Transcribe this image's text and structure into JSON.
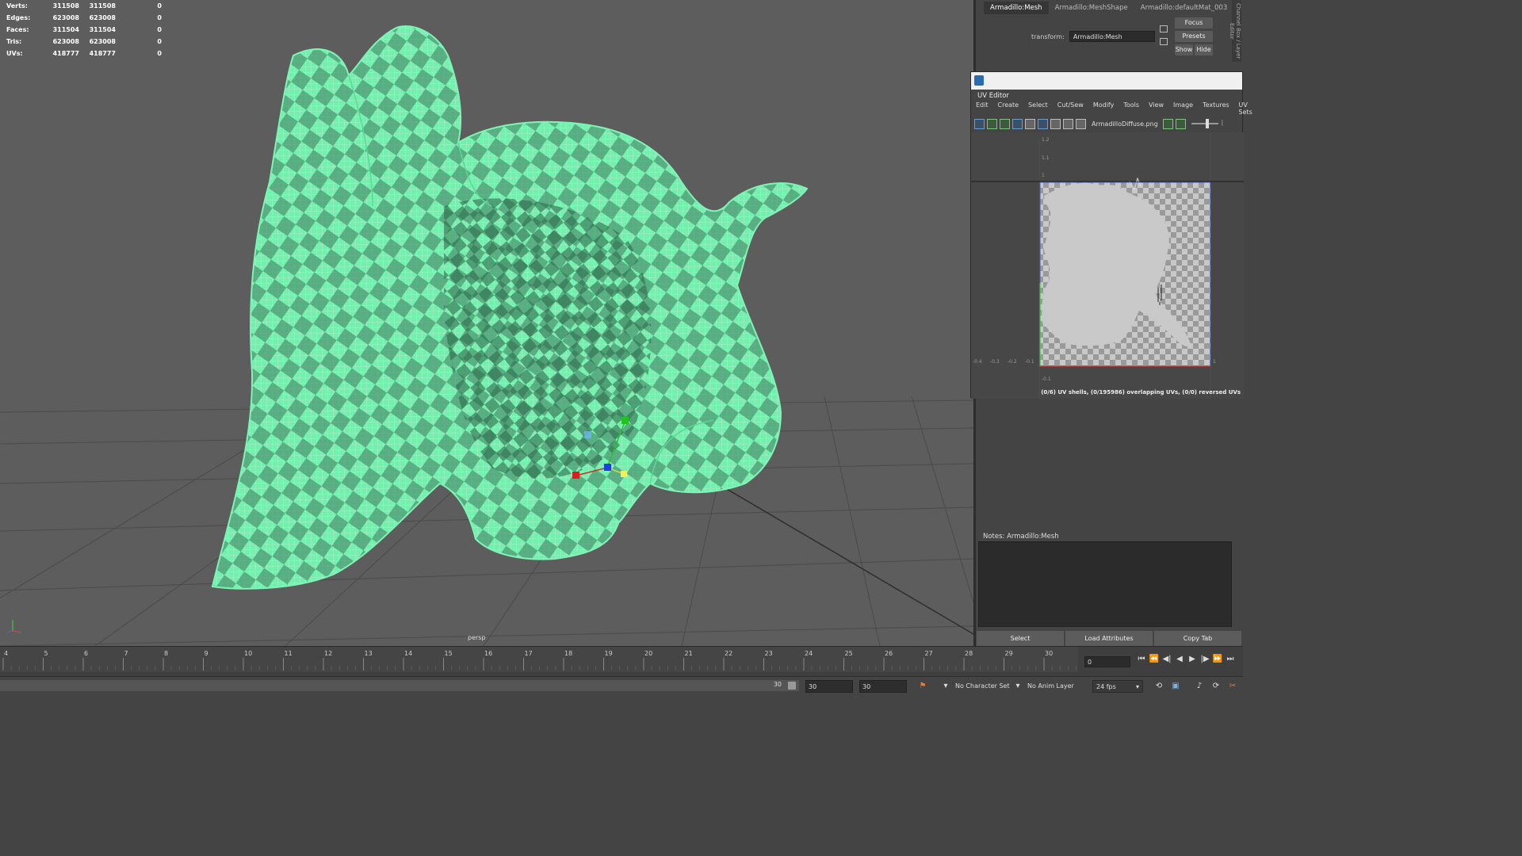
{
  "hud": {
    "rows": [
      {
        "label": "Verts:",
        "a": "311508",
        "b": "311508",
        "c": "0"
      },
      {
        "label": "Edges:",
        "a": "623008",
        "b": "623008",
        "c": "0"
      },
      {
        "label": "Faces:",
        "a": "311504",
        "b": "311504",
        "c": "0"
      },
      {
        "label": "Tris:",
        "a": "623008",
        "b": "623008",
        "c": "0"
      },
      {
        "label": "UVs:",
        "a": "418777",
        "b": "418777",
        "c": "0"
      }
    ]
  },
  "viewport": {
    "camera_label": "persp",
    "mesh_color": "#6ff0a6"
  },
  "attribute_editor": {
    "tabs": [
      "Armadillo:Mesh",
      "Armadillo:MeshShape",
      "Armadillo:defaultMat_003"
    ],
    "transform_label": "transform:",
    "transform_value": "Armadillo:Mesh",
    "focus_label": "Focus",
    "presets_label": "Presets",
    "show_label": "Show",
    "hide_label": "Hide",
    "side_tab": "Channel Box / Layer Editor",
    "notes_label": "Notes:  Armadillo:Mesh",
    "buttons": [
      "Select",
      "Load Attributes",
      "Copy Tab"
    ]
  },
  "uv_editor": {
    "title": "UV Editor",
    "menu": [
      "Edit",
      "Create",
      "Select",
      "Cut/Sew",
      "Modify",
      "Tools",
      "View",
      "Image",
      "Textures",
      "UV Sets"
    ],
    "texture_name": "ArmadilloDiffuse.png",
    "status": "(0/6) UV shells, (0/195986) overlapping UVs, (0/0) reversed UVs",
    "v_ticks": [
      "1.2",
      "1.1",
      "1"
    ],
    "u_ticks": [
      "-0.4",
      "-0.3",
      "-0.2",
      "-0.1"
    ],
    "bottom_tick": "-0.1",
    "right_tick": "1"
  },
  "timeline": {
    "frames": [
      "4",
      "5",
      "6",
      "7",
      "8",
      "9",
      "10",
      "11",
      "12",
      "13",
      "14",
      "15",
      "16",
      "17",
      "18",
      "19",
      "20",
      "21",
      "22",
      "23",
      "24",
      "25",
      "26",
      "27",
      "28",
      "29",
      "30"
    ],
    "current_frame": "0",
    "controls": [
      "⏮",
      "⏪",
      "◀|",
      "◀",
      "▶",
      "|▶",
      "⏩",
      "⏭"
    ]
  },
  "range_bar": {
    "range_end": "30",
    "start_field": "30",
    "end_field": "30",
    "character_set": "No Character Set",
    "anim_layer": "No Anim Layer",
    "fps": "24 fps"
  }
}
